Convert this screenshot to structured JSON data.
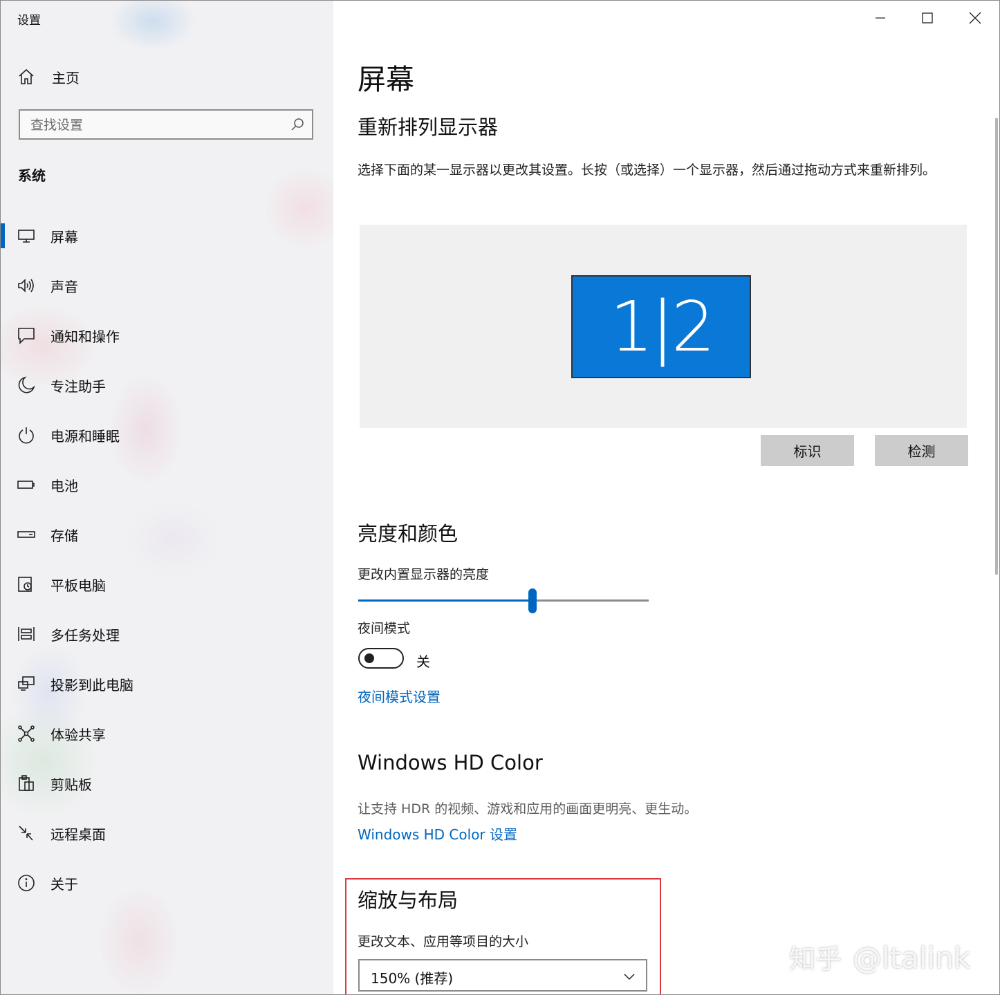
{
  "window": {
    "app_title": "设置",
    "controls": {
      "minimize": "minimize-icon",
      "maximize": "maximize-icon",
      "close": "close-icon"
    }
  },
  "sidebar": {
    "home_label": "主页",
    "search_placeholder": "查找设置",
    "section_label": "系统",
    "items": [
      {
        "label": "屏幕",
        "icon": "monitor-icon",
        "active": true
      },
      {
        "label": "声音",
        "icon": "speaker-icon"
      },
      {
        "label": "通知和操作",
        "icon": "notification-icon"
      },
      {
        "label": "专注助手",
        "icon": "moon-icon"
      },
      {
        "label": "电源和睡眠",
        "icon": "power-icon"
      },
      {
        "label": "电池",
        "icon": "battery-icon"
      },
      {
        "label": "存储",
        "icon": "storage-icon"
      },
      {
        "label": "平板电脑",
        "icon": "tablet-icon"
      },
      {
        "label": "多任务处理",
        "icon": "multitask-icon"
      },
      {
        "label": "投影到此电脑",
        "icon": "project-icon"
      },
      {
        "label": "体验共享",
        "icon": "share-icon"
      },
      {
        "label": "剪贴板",
        "icon": "clipboard-icon"
      },
      {
        "label": "远程桌面",
        "icon": "remote-desktop-icon"
      },
      {
        "label": "关于",
        "icon": "info-icon"
      }
    ]
  },
  "content": {
    "page_title": "屏幕",
    "rearrange": {
      "heading": "重新排列显示器",
      "description": "选择下面的某一显示器以更改其设置。长按（或选择）一个显示器，然后通过拖动方式来重新排列。",
      "monitor_label": "1|2",
      "identify_button": "标识",
      "detect_button": "检测"
    },
    "brightness": {
      "heading": "亮度和颜色",
      "slider_label": "更改内置显示器的亮度",
      "brightness_value": 0.6,
      "night_mode_label": "夜间模式",
      "night_mode_state": "关",
      "night_mode_on": false,
      "night_mode_link": "夜间模式设置"
    },
    "hd_color": {
      "heading": "Windows HD Color",
      "description": "让支持 HDR 的视频、游戏和应用的画面更明亮、更生动。",
      "link": "Windows HD Color 设置"
    },
    "scale": {
      "heading": "缩放与布局",
      "label": "更改文本、应用等项目的大小",
      "selected": "150% (推荐)"
    }
  },
  "watermark": {
    "logo": "知乎",
    "handle": "@ltalink"
  },
  "colors": {
    "accent": "#0067c0",
    "monitor": "#0a78d7",
    "highlight": "#e0383f"
  }
}
